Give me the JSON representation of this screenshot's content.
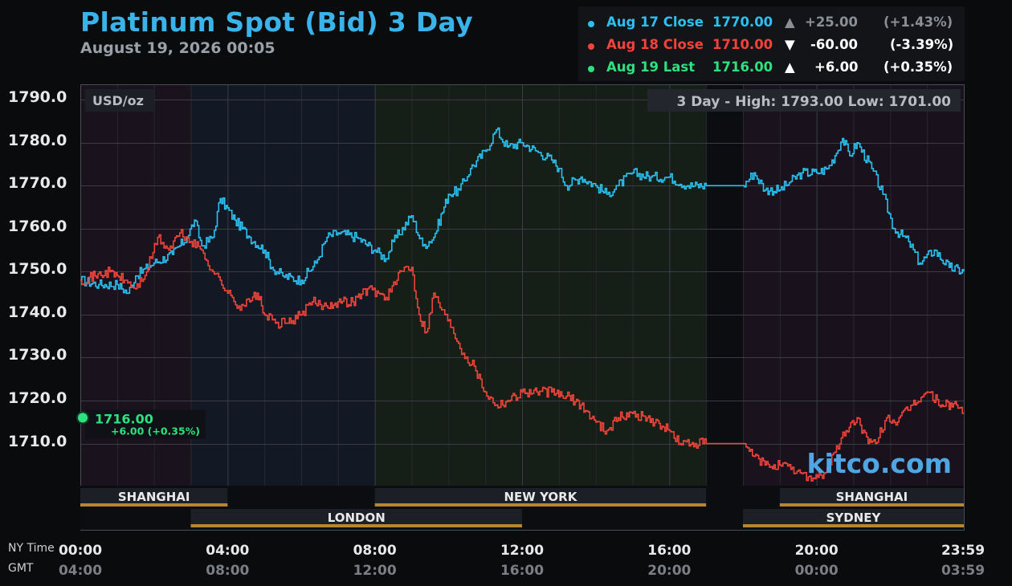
{
  "header": {
    "title": "Platinum Spot (Bid) 3 Day",
    "subtitle": "August 19, 2026 00:05"
  },
  "legend": [
    {
      "label": "Aug 17 Close",
      "value": "1770.00",
      "arrow": "▲",
      "change": "+25.00",
      "pct": "(+1.43%)",
      "color": "#2cc0f0",
      "arrow_color": "#8a8f96"
    },
    {
      "label": "Aug 18 Close",
      "value": "1710.00",
      "arrow": "▼",
      "change": "-60.00",
      "pct": "(-3.39%)",
      "color": "#f0433a",
      "arrow_color": "#ffffff"
    },
    {
      "label": "Aug 19 Last",
      "value": "1716.00",
      "arrow": "▲",
      "change": "+6.00",
      "pct": "(+0.35%)",
      "color": "#2fe07e",
      "arrow_color": "#ffffff"
    }
  ],
  "axis": {
    "unit_label": "USD/oz",
    "high_low": "3 Day - High: 1793.00  Low: 1701.00",
    "y_ticks": [
      "1790.0",
      "1780.0",
      "1770.0",
      "1760.0",
      "1750.0",
      "1740.0",
      "1730.0",
      "1720.0",
      "1710.0"
    ],
    "x_ticks_ny": [
      "00:00",
      "04:00",
      "08:00",
      "12:00",
      "16:00",
      "20:00",
      "23:59"
    ],
    "x_ticks_gmt": [
      "04:00",
      "08:00",
      "12:00",
      "16:00",
      "20:00",
      "00:00",
      "03:59"
    ],
    "ny_time_label": "NY Time",
    "gmt_label": "GMT"
  },
  "last_marker": {
    "value": "1716.00",
    "change": "+6.00 (+0.35%)"
  },
  "sessions": {
    "shanghai_1": "SHANGHAI",
    "new_york": "NEW YORK",
    "shanghai_2": "SHANGHAI",
    "london": "LONDON",
    "sydney": "SYDNEY"
  },
  "watermark": "kitco.com",
  "colors": {
    "aug17": "#2cc0f0",
    "aug18": "#f0433a",
    "aug19": "#2fe07e",
    "title": "#3ab3e8",
    "session_bar": "#b8862f"
  },
  "chart_data": {
    "type": "line",
    "title": "Platinum Spot (Bid) 3 Day",
    "ylabel": "USD/oz",
    "ylim": [
      1700,
      1793
    ],
    "xlim_hours": [
      0,
      24
    ],
    "series": [
      {
        "name": "Aug 17 Close",
        "x": [
          0,
          0.5,
          1,
          1.3,
          1.5,
          2,
          2.5,
          2.9,
          3.1,
          3.3,
          3.6,
          3.8,
          4.2,
          4.6,
          5,
          5.2,
          5.5,
          6,
          6.4,
          6.7,
          7,
          7.5,
          8,
          8.3,
          8.5,
          9,
          9.3,
          9.6,
          10,
          10.3,
          10.6,
          11,
          11.3,
          11.6,
          12,
          12.4,
          12.8,
          13,
          13.2,
          13.6,
          14,
          14.3,
          14.6,
          15,
          15.5,
          16,
          16.5,
          17,
          18,
          18.3,
          18.6,
          19,
          19.3,
          19.6,
          20,
          20.3,
          20.5,
          20.7,
          20.9,
          21.1,
          21.5,
          21.8,
          22.1,
          22.5,
          22.8,
          23.2,
          23.6,
          24
        ],
        "values": [
          1748,
          1747,
          1747,
          1745,
          1749,
          1752,
          1754,
          1758,
          1762,
          1756,
          1758,
          1767,
          1762,
          1758,
          1755,
          1751,
          1749,
          1748,
          1752,
          1758,
          1759,
          1758,
          1755,
          1753,
          1757,
          1763,
          1756,
          1758,
          1768,
          1769,
          1774,
          1778,
          1783,
          1779,
          1780,
          1778,
          1776,
          1774,
          1770,
          1772,
          1770,
          1768,
          1770,
          1773,
          1772,
          1772,
          1770,
          1770,
          1770,
          1773,
          1769,
          1769,
          1771,
          1773,
          1773,
          1774,
          1777,
          1781,
          1777,
          1780,
          1774,
          1768,
          1760,
          1757,
          1752,
          1755,
          1751,
          1750
        ]
      },
      {
        "name": "Aug 18 Close",
        "x": [
          0,
          0.4,
          0.8,
          1.2,
          1.5,
          1.8,
          2.1,
          2.4,
          2.7,
          3,
          3.3,
          3.6,
          3.8,
          4,
          4.3,
          4.6,
          4.8,
          5,
          5.3,
          5.6,
          6,
          6.3,
          6.6,
          7,
          7.4,
          7.8,
          8.1,
          8.3,
          8.6,
          8.8,
          9,
          9.2,
          9.4,
          9.6,
          9.9,
          10.1,
          10.4,
          10.7,
          11,
          11.3,
          11.6,
          12,
          12.4,
          12.8,
          13.2,
          13.6,
          14,
          14.3,
          14.6,
          15,
          15.4,
          15.8,
          16,
          16.3,
          16.7,
          17,
          18,
          18.3,
          18.6,
          19,
          19.3,
          19.6,
          19.9,
          20.2,
          20.5,
          20.8,
          21.1,
          21.4,
          21.6,
          21.9,
          22.2,
          22.6,
          23,
          23.4,
          23.8,
          24
        ],
        "values": [
          1748,
          1749,
          1750,
          1748,
          1746,
          1750,
          1758,
          1755,
          1759,
          1757,
          1755,
          1750,
          1748,
          1745,
          1742,
          1743,
          1745,
          1740,
          1738,
          1738,
          1740,
          1743,
          1742,
          1743,
          1743,
          1746,
          1745,
          1744,
          1748,
          1751,
          1751,
          1740,
          1736,
          1745,
          1740,
          1737,
          1731,
          1728,
          1722,
          1719,
          1720,
          1722,
          1722,
          1722,
          1721,
          1719,
          1715,
          1713,
          1716,
          1717,
          1716,
          1714,
          1713,
          1710,
          1710,
          1710,
          1710,
          1707,
          1705,
          1705,
          1704,
          1703,
          1702,
          1703,
          1708,
          1713,
          1716,
          1710,
          1710,
          1716,
          1715,
          1719,
          1722,
          1719,
          1719,
          1717
        ]
      },
      {
        "name": "Aug 19 Last",
        "x": [
          0
        ],
        "values": [
          1716
        ]
      }
    ]
  }
}
